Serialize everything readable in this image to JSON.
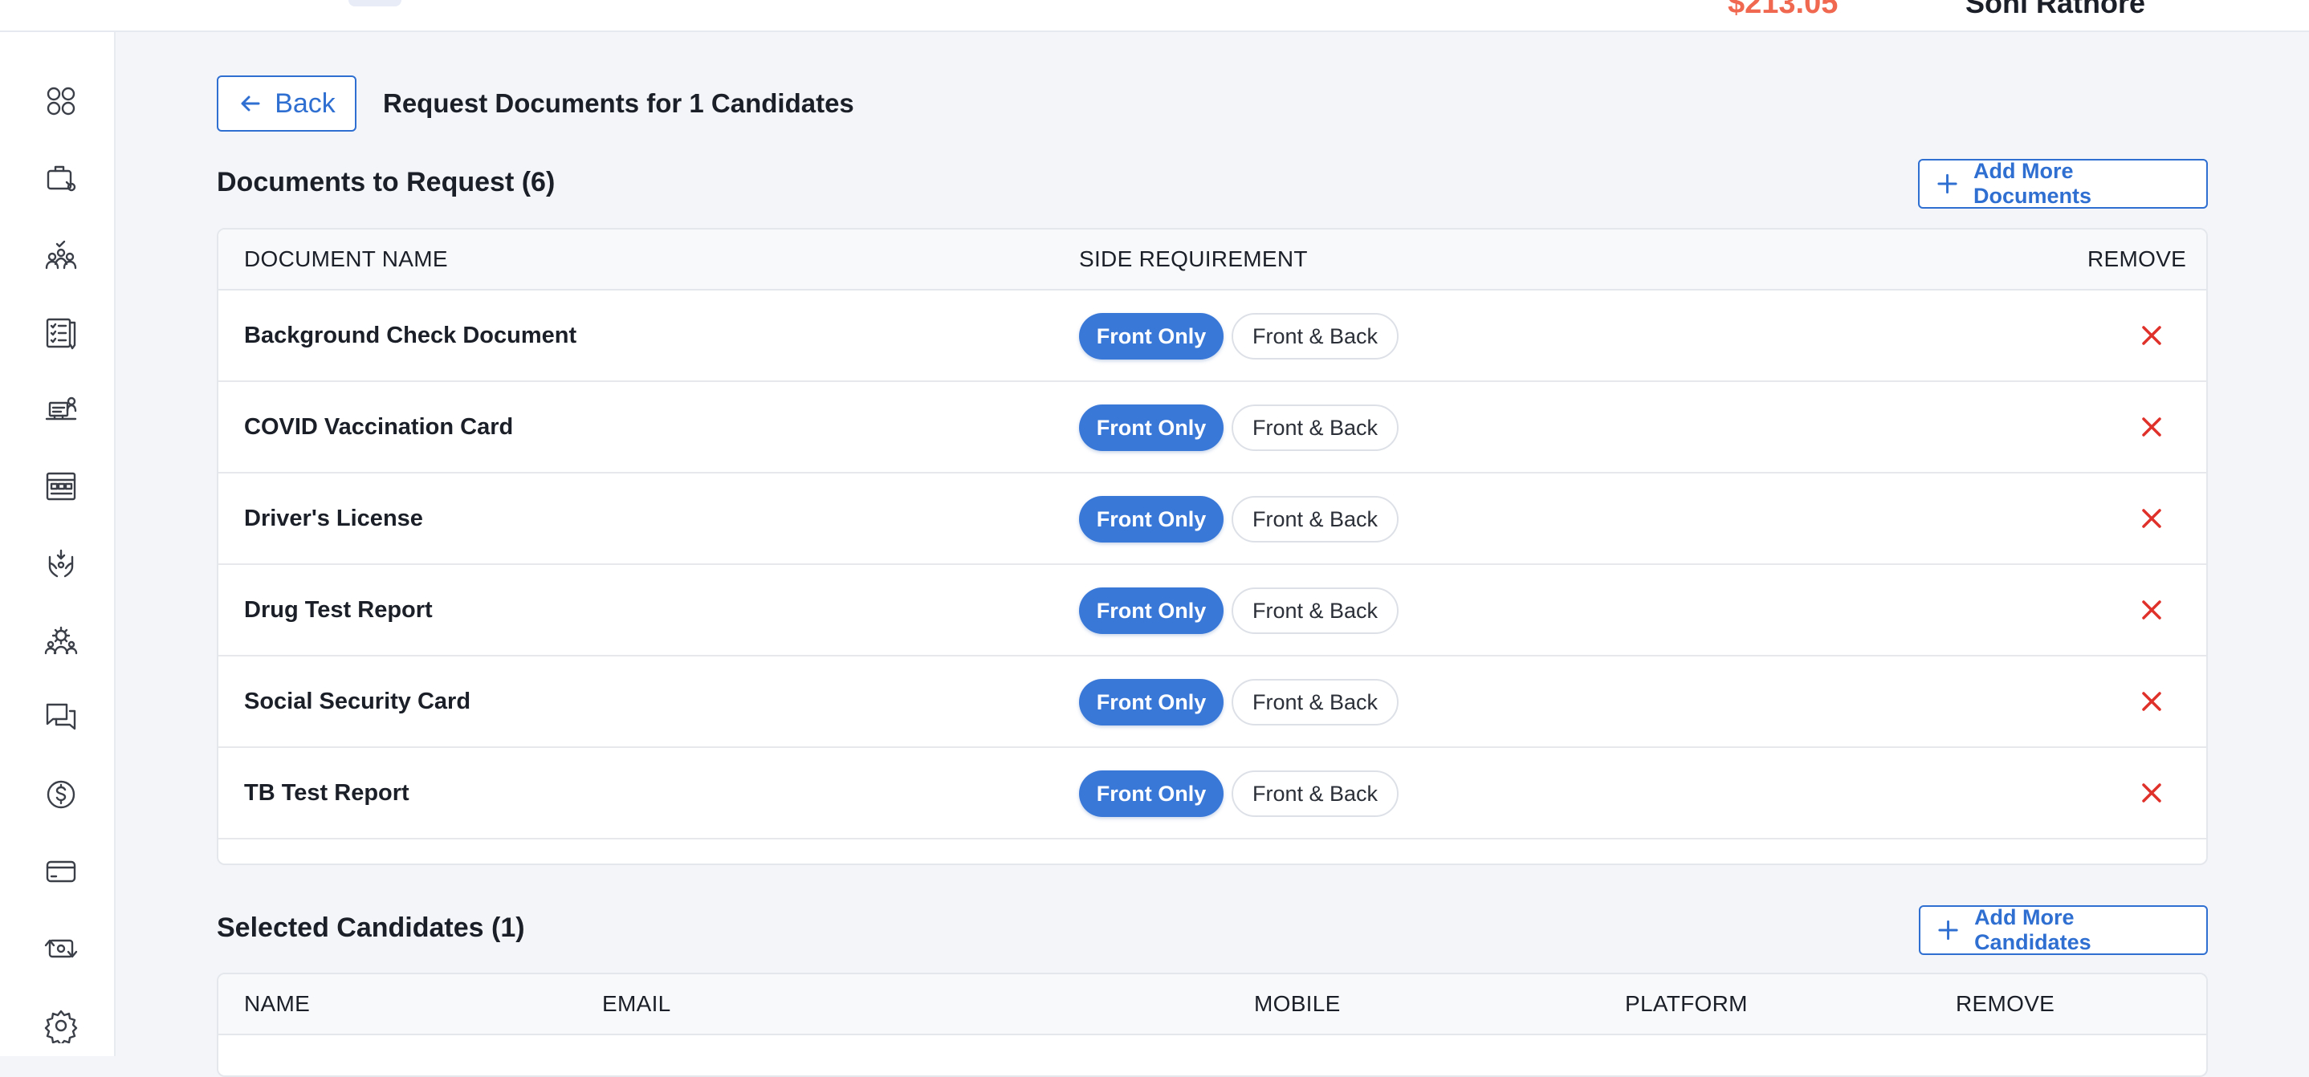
{
  "topbar": {
    "balance": "$213.05",
    "user_name": "Soni Rathore"
  },
  "sidebar": {
    "items": [
      {
        "icon": "dashboard-grid-icon"
      },
      {
        "icon": "jobs-briefcase-icon"
      },
      {
        "icon": "candidates-team-icon"
      },
      {
        "icon": "checklist-document-icon"
      },
      {
        "icon": "desk-worker-icon"
      },
      {
        "icon": "schedule-board-icon"
      },
      {
        "icon": "hands-care-icon"
      },
      {
        "icon": "group-settings-icon"
      },
      {
        "icon": "messages-chat-icon"
      },
      {
        "icon": "dollar-circle-icon"
      },
      {
        "icon": "credit-card-icon"
      },
      {
        "icon": "money-exchange-icon"
      },
      {
        "icon": "settings-gear-icon"
      }
    ]
  },
  "header": {
    "back_label": "Back",
    "title": "Request Documents for 1 Candidates"
  },
  "documents": {
    "title": "Documents to Request (6)",
    "add_label": "Add More Documents",
    "columns": {
      "name": "DOCUMENT NAME",
      "side": "SIDE REQUIREMENT",
      "remove": "REMOVE"
    },
    "option_front": "Front Only",
    "option_both": "Front & Back",
    "rows": [
      {
        "name": "Background Check Document",
        "selected": "Front Only"
      },
      {
        "name": "COVID Vaccination Card",
        "selected": "Front Only"
      },
      {
        "name": "Driver's License",
        "selected": "Front Only"
      },
      {
        "name": "Drug Test Report",
        "selected": "Front Only"
      },
      {
        "name": "Social Security Card",
        "selected": "Front Only"
      },
      {
        "name": "TB Test Report",
        "selected": "Front Only"
      }
    ]
  },
  "candidates": {
    "title": "Selected Candidates (1)",
    "add_label": "Add More Candidates",
    "columns": {
      "name": "NAME",
      "email": "EMAIL",
      "mobile": "MOBILE",
      "platform": "PLATFORM",
      "remove": "REMOVE"
    }
  },
  "colors": {
    "accent": "#3a78d8",
    "remove": "#e0302a",
    "balance": "#f0684f"
  }
}
